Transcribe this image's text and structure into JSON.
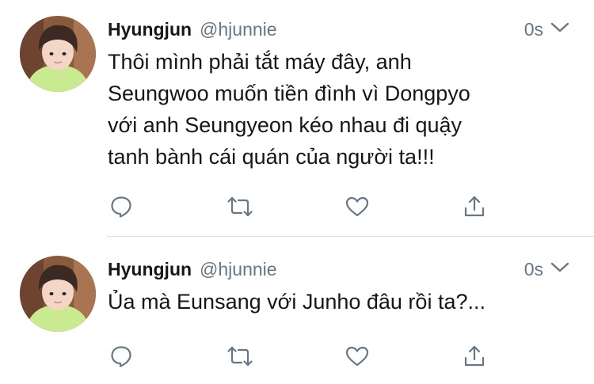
{
  "colors": {
    "text": "#14171a",
    "secondary": "#657786",
    "divider": "#d9dee2",
    "icon": "#657786"
  },
  "tweets": [
    {
      "author": "Hyungjun",
      "handle": "@hjunnie",
      "time": "0s",
      "lines": [
        "Thôi mình phải tắt máy đây, anh",
        "Seungwoo muốn tiền đình vì Dongpyo",
        "với anh Seungyeon kéo nhau đi quậy",
        "tanh bành cái quán của người ta!!!"
      ],
      "actions": [
        "reply-icon",
        "retweet-icon",
        "like-icon",
        "share-icon"
      ]
    },
    {
      "author": "Hyungjun",
      "handle": "@hjunnie",
      "time": "0s",
      "lines": [
        "Ủa mà Eunsang với Junho đâu rồi ta?..."
      ],
      "actions": [
        "reply-icon",
        "retweet-icon",
        "like-icon",
        "share-icon"
      ]
    }
  ]
}
